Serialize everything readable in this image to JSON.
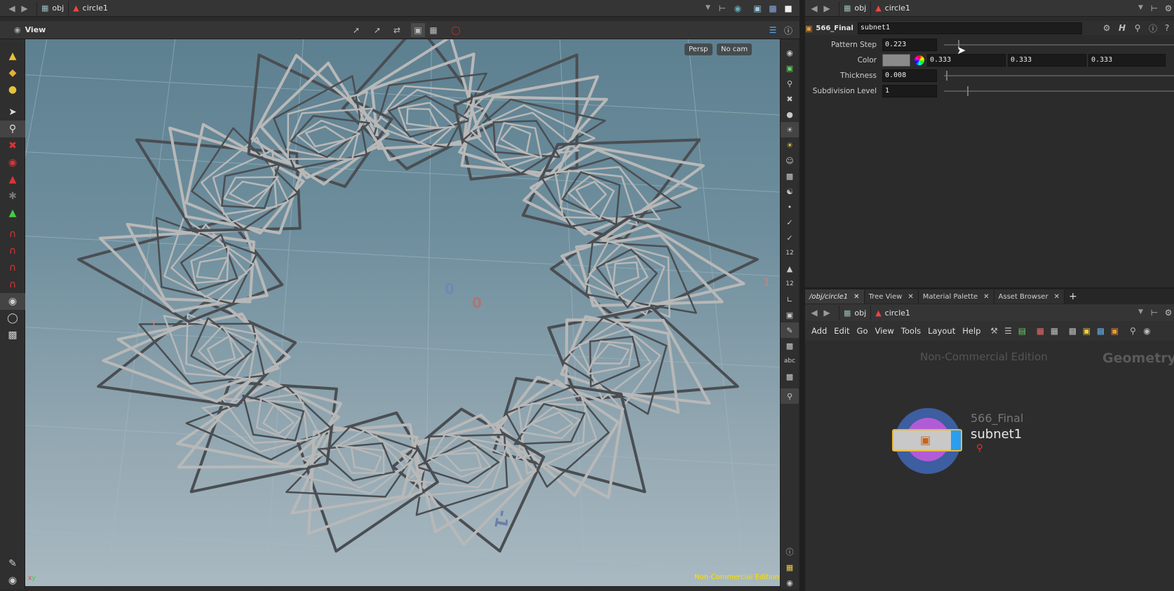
{
  "left_pathbar": {
    "network": "obj",
    "node": "circle1"
  },
  "viewport_toolbar": {
    "title": "View"
  },
  "viewport": {
    "camera_persp": "Persp",
    "camera_cam": "No cam",
    "watermark": "Non-Commercial Edition"
  },
  "right_pathbar": {
    "network": "obj",
    "node": "circle1"
  },
  "params": {
    "node_type": "566_Final",
    "node_name": "subnet1",
    "rows": [
      {
        "label": "Pattern Step",
        "value": "0.223",
        "slider_fraction": 0.06
      },
      {
        "label": "Color",
        "values": [
          "0.333",
          "0.333",
          "0.333"
        ],
        "swatch": "#8a8a8a"
      },
      {
        "label": "Thickness",
        "value": "0.008",
        "slider_fraction": 0.01
      },
      {
        "label": "Subdivision Level",
        "value": "1",
        "slider_fraction": 0.1
      }
    ]
  },
  "network": {
    "tabs": [
      "/obj/circle1",
      "Tree View",
      "Material Palette",
      "Asset Browser"
    ],
    "path": {
      "network": "obj",
      "node": "circle1"
    },
    "menus": [
      "Add",
      "Edit",
      "Go",
      "View",
      "Tools",
      "Layout",
      "Help"
    ],
    "edition_watermark": "Non-Commercial Edition",
    "context_label": "Geometry",
    "node": {
      "type_label": "566_Final",
      "name": "subnet1"
    }
  },
  "colors": {
    "viewport_top": "#5d8090",
    "viewport_bottom": "#a9b9c1",
    "node_ring": "#3d5ea0",
    "node_inner": "#b25bd6",
    "node_body": "#c8c8c8",
    "node_flag": "#2a9ef0",
    "watermark": "#ffe000"
  },
  "icons": [
    "back-arrow-icon",
    "forward-arrow-icon",
    "network-icon",
    "object-icon",
    "pin-icon",
    "gear-icon",
    "help-icon",
    "select-icon",
    "lock-icon",
    "magnet-icon",
    "camera-icon",
    "light-icon",
    "info-icon",
    "eye-icon",
    "search-icon",
    "add-tab-icon"
  ]
}
